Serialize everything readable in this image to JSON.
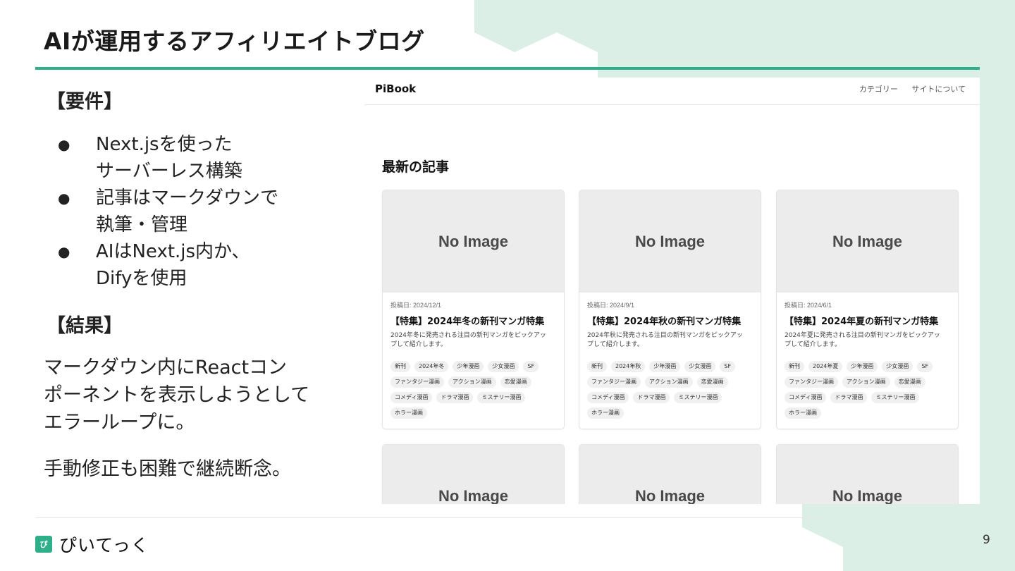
{
  "slide": {
    "title": "AIが運用するアフィリエイトブログ",
    "requirements_heading": "【要件】",
    "requirements": [
      [
        "Next.jsを使った",
        "サーバーレス構築"
      ],
      [
        "記事はマークダウンで",
        "執筆・管理"
      ],
      [
        "AIはNext.js内か、",
        "Difyを使用"
      ]
    ],
    "results_heading": "【結果】",
    "result_lines": [
      "マークダウン内にReactコン",
      "ポーネントを表示しようとして",
      "エラーループに。"
    ],
    "result_line2": "手動修正も困難で継続断念。",
    "bullet_glyph": "●",
    "page_number": "9",
    "logo_mark": "ぴ",
    "logo_text": "ぴいてっく"
  },
  "site": {
    "brand": "PiBook",
    "nav": [
      "カテゴリー",
      "サイトについて"
    ],
    "latest_heading": "最新の記事",
    "cards": [
      {
        "image_text": "No Image",
        "date": "投稿日: 2024/12/1",
        "title": "【特集】2024年冬の新刊マンガ特集",
        "desc_lines": [
          "2024年冬に発売される注目の新刊マンガをピックアッ",
          "プして紹介します。"
        ],
        "tags": [
          "新刊",
          "2024年冬",
          "少年漫画",
          "少女漫画",
          "SF",
          "ファンタジー漫画",
          "アクション漫画",
          "恋愛漫画",
          "コメディ漫画",
          "ドラマ漫画",
          "ミステリー漫画",
          "ホラー漫画"
        ]
      },
      {
        "image_text": "No Image",
        "date": "投稿日: 2024/9/1",
        "title": "【特集】2024年秋の新刊マンガ特集",
        "desc_lines": [
          "2024年秋に発売される注目の新刊マンガをピックアッ",
          "プして紹介します。"
        ],
        "tags": [
          "新刊",
          "2024年秋",
          "少年漫画",
          "少女漫画",
          "SF",
          "ファンタジー漫画",
          "アクション漫画",
          "恋愛漫画",
          "コメディ漫画",
          "ドラマ漫画",
          "ミステリー漫画",
          "ホラー漫画"
        ]
      },
      {
        "image_text": "No Image",
        "date": "投稿日: 2024/6/1",
        "title": "【特集】2024年夏の新刊マンガ特集",
        "desc_lines": [
          "2024年夏に発売される注目の新刊マンガをピックアッ",
          "プして紹介します。"
        ],
        "tags": [
          "新刊",
          "2024年夏",
          "少年漫画",
          "少女漫画",
          "SF",
          "ファンタジー漫画",
          "アクション漫画",
          "恋愛漫画",
          "コメディ漫画",
          "ドラマ漫画",
          "ミステリー漫画",
          "ホラー漫画"
        ]
      },
      {
        "image_text": "No Image"
      },
      {
        "image_text": "No Image"
      },
      {
        "image_text": "No Image"
      }
    ]
  },
  "colors": {
    "accent": "#2fae8a",
    "decor": "#dcefe6",
    "placeholder": "#ececec"
  }
}
